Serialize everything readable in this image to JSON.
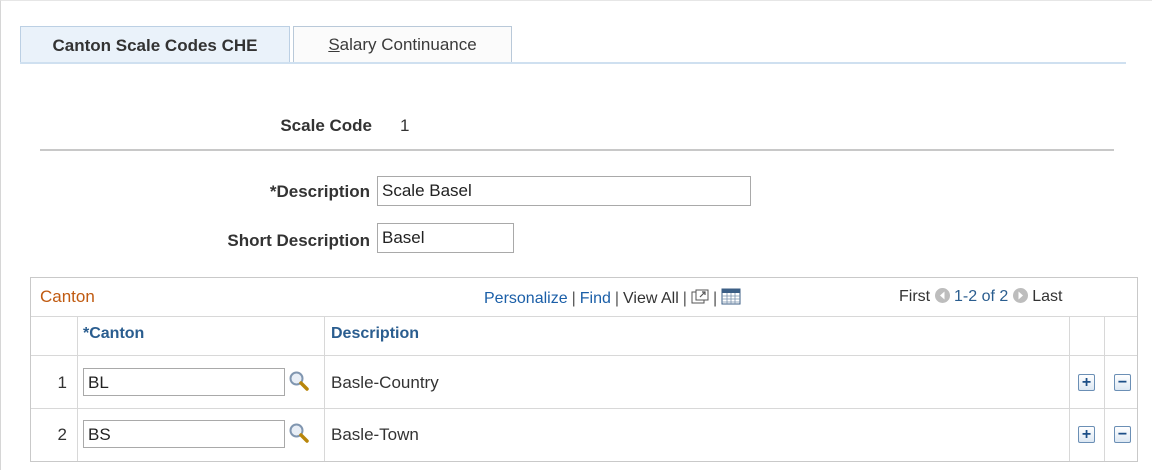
{
  "tabs": [
    {
      "label": "Canton Scale Codes CHE",
      "active": true
    },
    {
      "label_accel": "S",
      "label_rest": "alary Continuance",
      "active": false
    }
  ],
  "form": {
    "scale_code_label": "Scale Code",
    "scale_code_value": "1",
    "description_label": "*Description",
    "description_value": "Scale Basel",
    "short_description_label": "Short Description",
    "short_description_value": "Basel"
  },
  "grid": {
    "title": "Canton",
    "toolbar": {
      "personalize": "Personalize",
      "find": "Find",
      "view_all": "View All",
      "first": "First",
      "range": "1-2 of 2",
      "last": "Last"
    },
    "columns": {
      "canton": "*Canton",
      "description": "Description"
    },
    "rows": [
      {
        "num": "1",
        "canton": "BL",
        "description": "Basle-Country"
      },
      {
        "num": "2",
        "canton": "BS",
        "description": "Basle-Town"
      }
    ]
  },
  "icons": {
    "lookup": "magnifier-icon",
    "zoom": "new-window-icon",
    "download": "spreadsheet-icon",
    "prev": "left-arrow-circle-icon",
    "next": "right-arrow-circle-icon",
    "add": "plus-icon",
    "delete": "minus-icon"
  },
  "colors": {
    "accent": "#1b5fa8",
    "grid_title": "#c05a10",
    "tab_active_bg": "#eaf2fa"
  }
}
